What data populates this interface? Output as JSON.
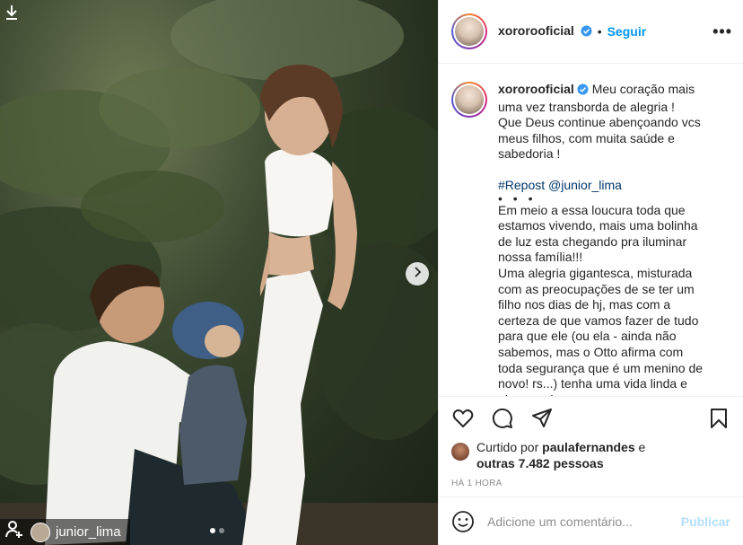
{
  "photo": {
    "repost_handle": "junior_lima",
    "carousel": {
      "count": 2,
      "active_index": 0
    },
    "next_icon": "chevron-right-icon",
    "download_icon": "download-arrow-icon",
    "repost_icon": "repost-icon"
  },
  "header": {
    "username": "xororooficial",
    "separator": "•",
    "follow_label": "Seguir",
    "more_label": "•••",
    "verified_icon": "verified-badge-icon"
  },
  "caption": {
    "username": "xororooficial",
    "line1": "Meu coração mais uma vez transborda de alegria !",
    "line2": "Que Deus continue abençoando vcs meus filhos, com muita saúde e sabedoria !",
    "repost_tag": "#Repost @junior_lima",
    "bullet": "• • •",
    "body1": "Em meio a essa loucura toda que estamos vivendo, mais uma bolinha de luz esta chegando pra iluminar nossa família!!!",
    "body2": "Uma alegria gigantesca, misturada com as preocupações de se ter um filho nos dias de hj, mas com a certeza de que vamos fazer de tudo para que ele (ou ela - ainda não sabemos, mas o Otto afirma com toda segurança que é um menino de novo! rs...) tenha uma vida linda e abençoada."
  },
  "actions": {
    "like_icon": "heart-icon",
    "comment_icon": "comment-icon",
    "share_icon": "share-icon",
    "save_icon": "bookmark-icon"
  },
  "likes": {
    "prefix": "Curtido por ",
    "liker": "paulafernandes",
    "conj": " e",
    "others": "outras 7.482 pessoas"
  },
  "timestamp": "HÁ 1 HORA",
  "comment": {
    "placeholder": "Adicione um comentário...",
    "publish_label": "Publicar",
    "emoji_icon": "smiley-icon"
  },
  "colors": {
    "link_blue": "#0095f6",
    "publish_disabled": "#b2dffc",
    "text": "#262626",
    "muted": "#8e8e8e",
    "hashtag": "#00376b"
  }
}
